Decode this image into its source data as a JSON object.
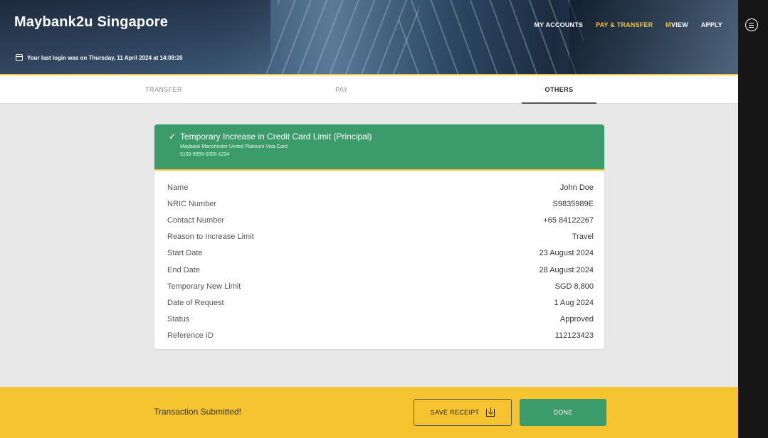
{
  "header": {
    "brand": "Maybank2u Singapore",
    "last_login": "Your last login was on Thursday, 11 April 2024 at 14:09:20",
    "nav": {
      "my_accounts": "MY ACCOUNTS",
      "pay_transfer": "PAY & TRANSFER",
      "mview_m": "M",
      "mview_rest": "VIEW",
      "apply": "APPLY"
    }
  },
  "tabs": {
    "transfer": "TRANSFER",
    "pay": "PAY",
    "others": "OTHERS"
  },
  "card": {
    "title": "Temporary Increase in Credit Card Limit (Principal)",
    "card_name": "Maybank Manchester United Platinum Visa Card",
    "card_number": "5100-9999-0000-1234",
    "rows": [
      {
        "label": "Name",
        "value": "John Doe"
      },
      {
        "label": "NRIC Number",
        "value": "S9835989E"
      },
      {
        "label": "Contact Number",
        "value": "+65 84122267"
      },
      {
        "label": "Reason to Increase Limit",
        "value": "Travel"
      },
      {
        "label": "Start Date",
        "value": "23 August 2024"
      },
      {
        "label": "End Date",
        "value": "28 August 2024"
      },
      {
        "label": "Temporary New Limit",
        "value": "SGD 8,800"
      },
      {
        "label": "Date of Request",
        "value": "1 Aug 2024"
      },
      {
        "label": "Status",
        "value": "Approved"
      },
      {
        "label": "Reference ID",
        "value": "112123423"
      }
    ]
  },
  "footer": {
    "message": "Transaction Submitted!",
    "save_label": "SAVE RECEIPT",
    "done_label": "DONE"
  },
  "colors": {
    "accent_gold": "#f6c431",
    "success_green": "#3c9b6a"
  }
}
